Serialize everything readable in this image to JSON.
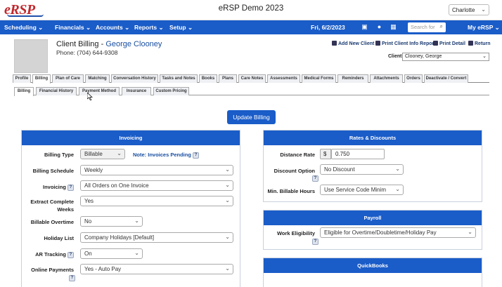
{
  "header": {
    "logo_text": "eRSP",
    "app_title": "eRSP Demo 2023",
    "location": "Charlotte"
  },
  "nav": {
    "items": [
      "Scheduling",
      "Financials",
      "Accounts",
      "Reports",
      "Setup"
    ],
    "date": "Fri, 6/2/2023",
    "search_placeholder": "Search for",
    "my_account": "My eRSP"
  },
  "client": {
    "page_label": "Client Billing - ",
    "name": "George Clooney",
    "phone": "Phone: (704) 644-9308",
    "selector_label": "Client:",
    "selector_value": "Clooney, George"
  },
  "util_links": [
    "Add New Client",
    "Print Client Info Report",
    "Print Detail",
    "Return"
  ],
  "main_tabs": [
    "Profile",
    "Billing",
    "Plan of Care",
    "Matching",
    "Conversation History",
    "Tasks and Notes",
    "Books",
    "Plans",
    "Care Notes",
    "Assessments",
    "Medical Forms",
    "Reminders",
    "Attachments",
    "Orders",
    "Deactivate / Convert"
  ],
  "sub_tabs": [
    "Billing",
    "Financial History",
    "Payment Method",
    "Insurance",
    "Custom Pricing"
  ],
  "update_button": "Update Billing",
  "invoicing": {
    "title": "Invoicing",
    "billing_type_label": "Billing Type",
    "billing_type_value": "Billable",
    "note": "Note: Invoices Pending",
    "billing_schedule_label": "Billing Schedule",
    "billing_schedule_value": "Weekly",
    "invoicing_label": "Invoicing",
    "invoicing_value": "All Orders on One Invoice",
    "extract_label_1": "Extract Complete",
    "extract_label_2": "Weeks",
    "extract_value": "Yes",
    "overtime_label": "Billable Overtime",
    "overtime_value": "No",
    "holiday_label": "Holiday List",
    "holiday_value": "Company Holidays [Default]",
    "ar_label": "AR Tracking",
    "ar_value": "On",
    "online_label": "Online Payments",
    "online_value": "Yes - Auto Pay"
  },
  "rates": {
    "title": "Rates & Discounts",
    "distance_label": "Distance Rate",
    "distance_prefix": "$",
    "distance_value": "0.750",
    "discount_label": "Discount Option",
    "discount_value": "No Discount",
    "min_hours_label": "Min. Billable Hours",
    "min_hours_value": "Use Service Code Minim"
  },
  "payroll": {
    "title": "Payroll",
    "work_label": "Work Eligibility",
    "work_value": "Eligible for Overtime/Doubletime/Holiday Pay"
  },
  "quickbooks": {
    "title": "QuickBooks"
  },
  "help_glyph": "?",
  "colors": {
    "primary_blue": "#1a5cc8",
    "logo_red": "#c0282d",
    "link_blue": "#1a4fa0"
  }
}
